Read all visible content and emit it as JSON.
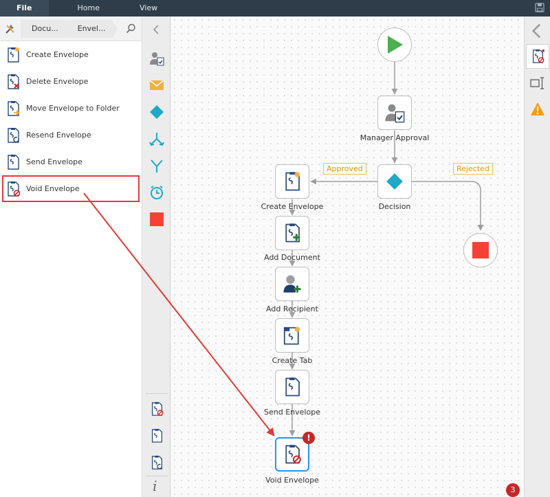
{
  "menubar": {
    "file": "File",
    "home": "Home",
    "view": "View"
  },
  "breadcrumb": {
    "segments": [
      "Docu...",
      "Envel..."
    ]
  },
  "actions": [
    {
      "label": "Create Envelope",
      "icon": "create-envelope-icon"
    },
    {
      "label": "Delete Envelope",
      "icon": "delete-envelope-icon"
    },
    {
      "label": "Move Envelope to Folder",
      "icon": "move-envelope-icon"
    },
    {
      "label": "Resend Envelope",
      "icon": "resend-envelope-icon"
    },
    {
      "label": "Send Envelope",
      "icon": "send-envelope-icon"
    },
    {
      "label": "Void Envelope",
      "icon": "void-envelope-icon"
    }
  ],
  "workflow": {
    "nodes": {
      "manager_approval": "Manager Approval",
      "decision": "Decision",
      "create_envelope": "Create Envelope",
      "add_document": "Add Document",
      "add_recipient": "Add Recipient",
      "create_tab": "Create Tab",
      "send_envelope": "Send Envelope",
      "void_envelope": "Void Envelope"
    },
    "branches": {
      "approved": "Approved",
      "rejected": "Rejected"
    },
    "warning_badge": "!"
  },
  "notifications": {
    "count": "3"
  },
  "palette": {
    "info": "i"
  },
  "colors": {
    "menubar": "#2f3d4a",
    "start_green": "#4caf50",
    "stop_red": "#f44336",
    "decision_teal": "#1eaac6",
    "envelope_orange": "#f5b041",
    "highlight_red": "#e53935",
    "selected_blue": "#2196f3",
    "badge_red": "#c62828"
  }
}
